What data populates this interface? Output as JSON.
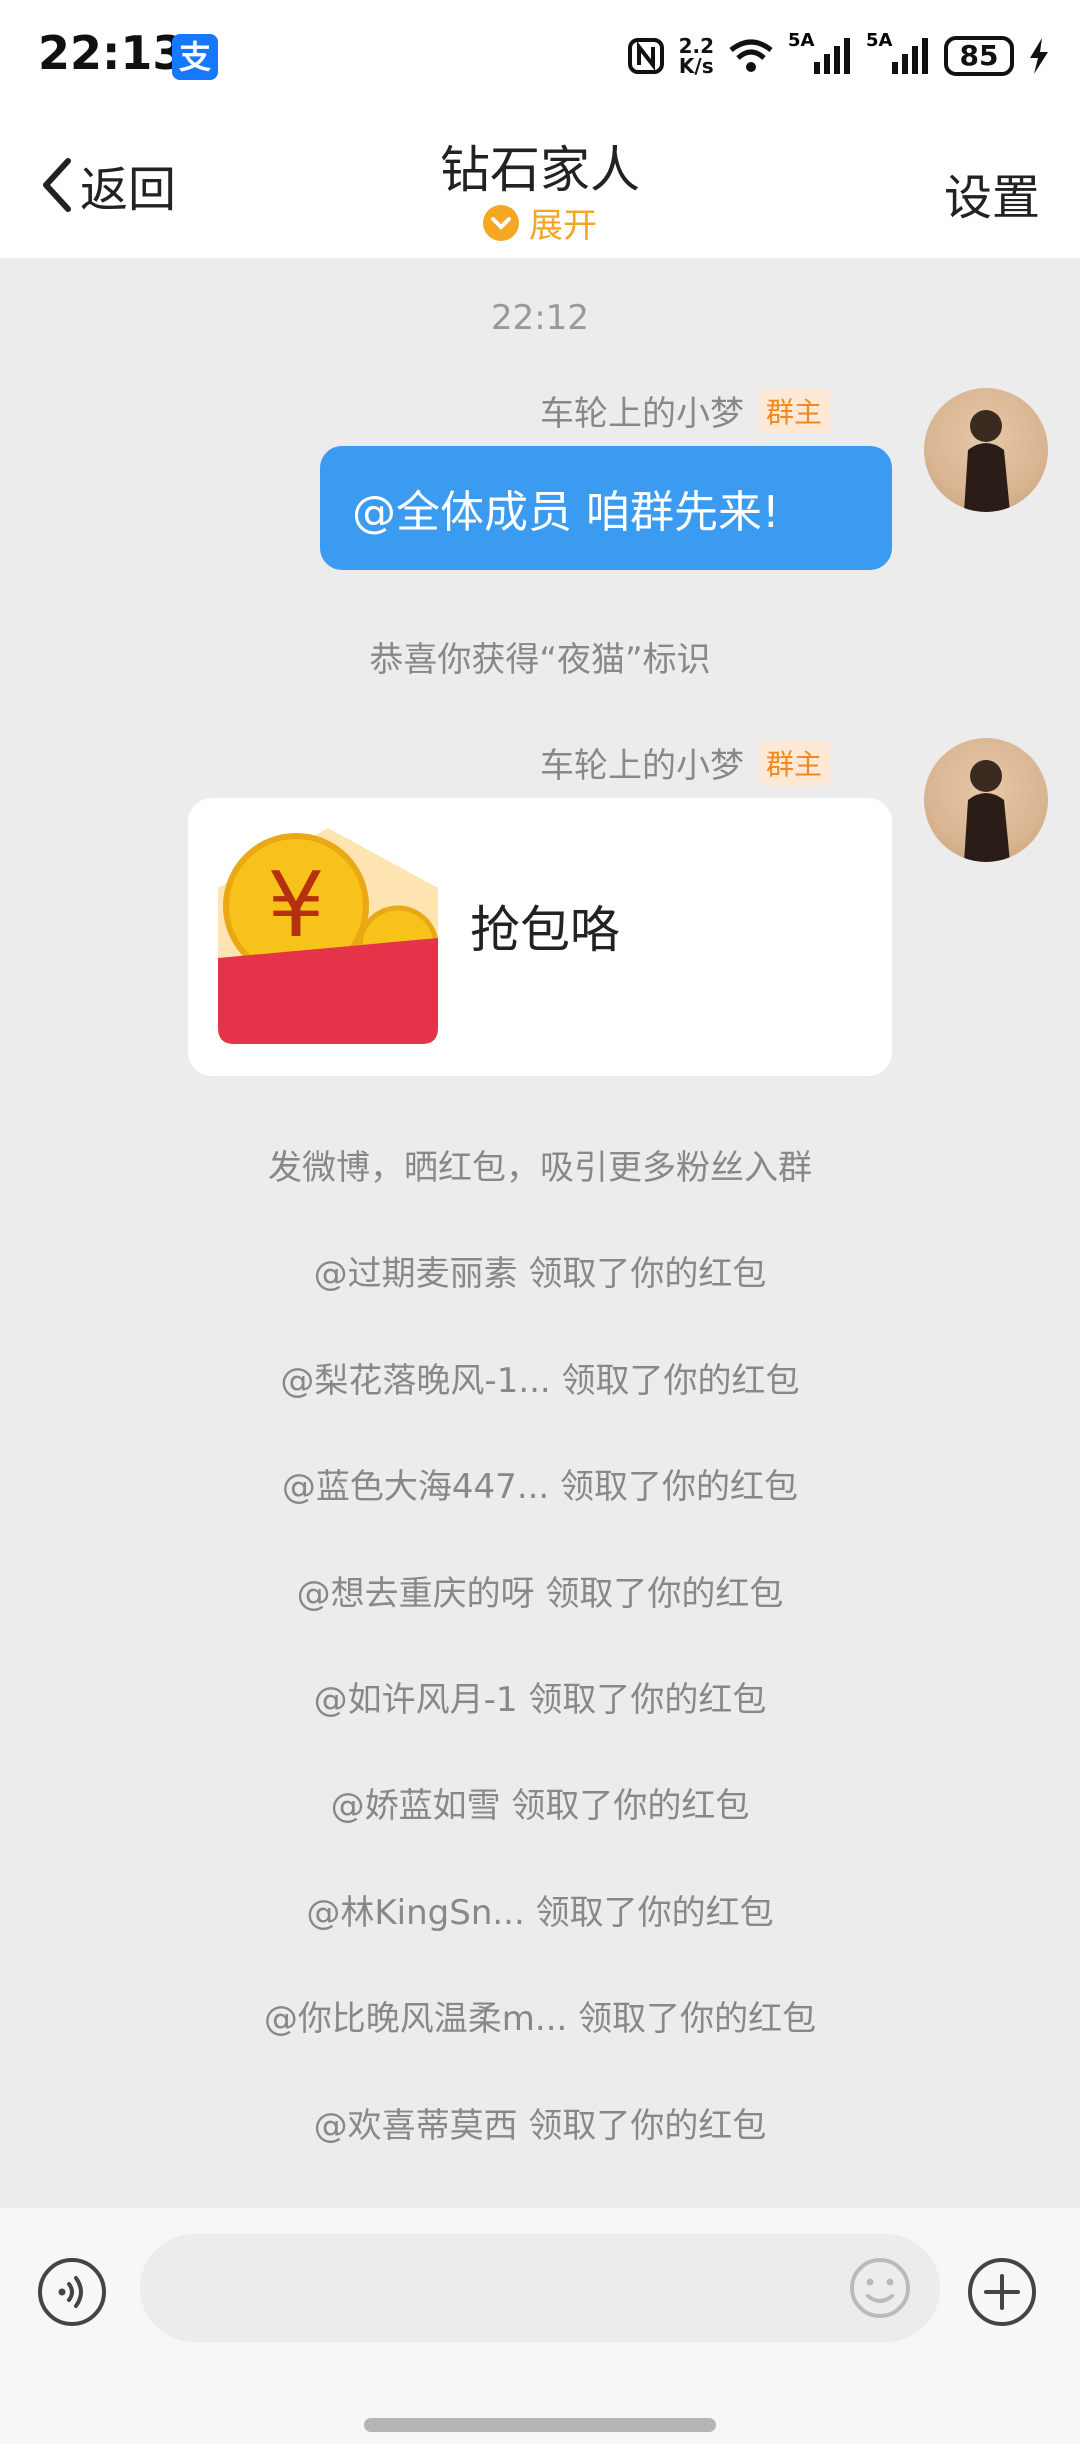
{
  "status": {
    "time": "22:13",
    "alipay_glyph": "支",
    "net_speed_top": "2.2",
    "net_speed_bottom": "K/s",
    "signal1": "5A",
    "signal2": "5A",
    "battery": "85",
    "icons": [
      "nfc-icon",
      "wifi-icon",
      "signal-icon",
      "signal-icon",
      "battery-icon",
      "charging-icon"
    ]
  },
  "nav": {
    "back_label": "返回",
    "title": "钻石家人",
    "expand_label": "展开",
    "settings_label": "设置"
  },
  "chat": {
    "timestamp": "22:12",
    "messages": [
      {
        "sender": "车轮上的小梦",
        "badge": "群主",
        "text": "@全体成员 咱群先来!"
      },
      {
        "sender": "车轮上的小梦",
        "badge": "群主",
        "redpacket_title": "抢包咯"
      }
    ],
    "system_notice": "恭喜你获得“夜猫”标识",
    "promo_notice": "发微博，晒红包，吸引更多粉丝入群",
    "claims": [
      "@过期麦丽素 领取了你的红包",
      "@梨花落晚风-1... 领取了你的红包",
      "@蓝色大海447... 领取了你的红包",
      "@想去重庆的呀 领取了你的红包",
      "@如许风月-1 领取了你的红包",
      "@娇蓝如雪 领取了你的红包",
      "@林KingSn... 领取了你的红包",
      "@你比晚风温柔m... 领取了你的红包",
      "@欢喜蒂莫西 领取了你的红包"
    ]
  },
  "colors": {
    "bubble": "#3a9bf0",
    "accent": "#f5a623",
    "redpacket": "#e5334a"
  }
}
